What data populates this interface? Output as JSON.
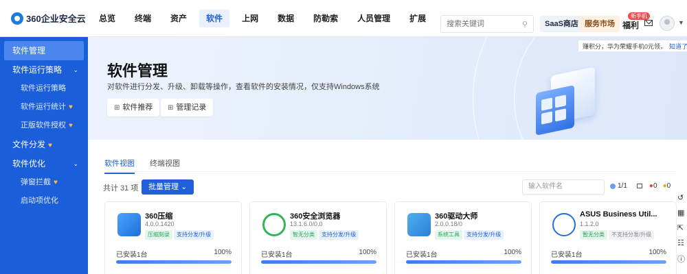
{
  "header": {
    "logo_text": "360企业安全云",
    "nav": [
      {
        "label": "总览",
        "active": false
      },
      {
        "label": "终端",
        "active": false
      },
      {
        "label": "资产",
        "active": false
      },
      {
        "label": "软件",
        "active": true
      },
      {
        "label": "上网",
        "active": false
      },
      {
        "label": "数据",
        "active": false
      },
      {
        "label": "防勒索",
        "active": false
      },
      {
        "label": "人员管理",
        "active": false
      },
      {
        "label": "扩展",
        "active": false
      }
    ],
    "search_placeholder": "搜索关键词",
    "saas_label": "SaaS商店",
    "market_label": "服务市场",
    "welfare_label": "福利",
    "new_badge": "新手机"
  },
  "tip": {
    "text": "赚积分，华为荣耀手机0元领，",
    "link": "知道了"
  },
  "sidebar": {
    "active_label": "软件管理",
    "group1": "软件运行策略",
    "group1_items": [
      "软件运行策略",
      "软件运行统计",
      "正版软件授权"
    ],
    "file_dist": "文件分发",
    "group2": "软件优化",
    "group2_items": [
      "弹窗拦截",
      "启动项优化"
    ]
  },
  "hero": {
    "title": "软件管理",
    "desc": "对软件进行分发、升级、卸载等操作，查看软件的安装情况，仅支持Windows系统",
    "btn_recommend": "软件推荐",
    "btn_log": "管理记录"
  },
  "tabs": [
    {
      "label": "软件视图",
      "active": true
    },
    {
      "label": "终端视图",
      "active": false
    }
  ],
  "toolbar": {
    "total": "共计 31 项",
    "batch": "批量管理",
    "search_placeholder": "输入软件名",
    "page": "1/1",
    "red_count": "0",
    "yellow_count": "0"
  },
  "cards": [
    {
      "name": "360压缩",
      "version": "4.0.0.1420",
      "tag1": "压缩刻录",
      "tag2": "支持分发/升级",
      "tag2_supported": true,
      "installed": "已安装1台",
      "percent_label": "100%",
      "percent": 100,
      "icon_color": "#3b8cf2",
      "icon": "zip-icon"
    },
    {
      "name": "360安全浏览器",
      "version": "13.1.6.0/0.0",
      "tag1": "智无分类",
      "tag2": "支持分发/升级",
      "tag2_supported": true,
      "installed": "已安装1台",
      "percent_label": "100%",
      "percent": 100,
      "icon_color": "#2fb356",
      "icon": "browser-icon"
    },
    {
      "name": "360驱动大师",
      "version": "2.0.0.18/0",
      "tag1": "系统工具",
      "tag2": "支持分发/升级",
      "tag2_supported": true,
      "installed": "已安装1台",
      "percent_label": "100%",
      "percent": 100,
      "icon_color": "#2c8bde",
      "icon": "driver-icon"
    },
    {
      "name": "ASUS Business Util...",
      "version": "1.1.2.0",
      "tag1": "暂无分类",
      "tag2": "不支持分发/升级",
      "tag2_supported": false,
      "installed": "已安装1台",
      "percent_label": "100%",
      "percent": 100,
      "icon_color": "#1f6fd6",
      "icon": "dropbox-icon"
    }
  ]
}
